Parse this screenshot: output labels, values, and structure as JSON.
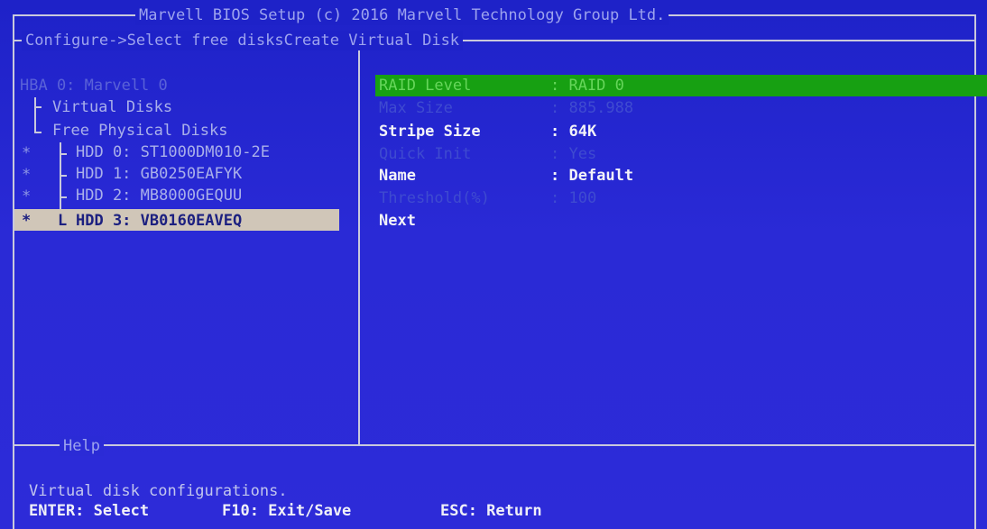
{
  "header": {
    "title": "Marvell BIOS Setup (c) 2016 Marvell Technology Group Ltd.",
    "breadcrumb": "Configure->Select free disksCreate Virtual Disk"
  },
  "tree": {
    "root": "HBA 0: Marvell 0",
    "virtual_disks": "Virtual Disks",
    "free_physical_disks": "Free Physical Disks",
    "disks": [
      {
        "marker": "*",
        "label": "HDD 0: ST1000DM010-2E",
        "selected": false
      },
      {
        "marker": "*",
        "label": "HDD 1: GB0250EAFYK",
        "selected": false
      },
      {
        "marker": "*",
        "label": "HDD 2: MB8000GEQUU",
        "selected": false
      },
      {
        "marker": "*",
        "label": "HDD 3: VB0160EAVEQ",
        "selected": true
      }
    ]
  },
  "config": {
    "rows": [
      {
        "label": "RAID Level",
        "value": ": RAID 0",
        "state": "highlight"
      },
      {
        "label": "Max Size",
        "value": ": 885.988",
        "state": "dim"
      },
      {
        "label": "Stripe Size",
        "value": ": 64K",
        "state": "normal"
      },
      {
        "label": "Quick Init",
        "value": ": Yes",
        "state": "dim"
      },
      {
        "label": "Name",
        "value": ": Default",
        "state": "normal"
      },
      {
        "label": "Threshold(%)",
        "value": ": 100",
        "state": "dim"
      },
      {
        "label": "Next",
        "value": "",
        "state": "normal"
      }
    ]
  },
  "help": {
    "title": "Help",
    "description": "Virtual disk configurations.",
    "keys": {
      "enter": "ENTER: Select",
      "f10": "F10: Exit/Save",
      "esc": "ESC: Return"
    }
  },
  "colors": {
    "background": "#2a2ad6",
    "highlight_bar": "#17a012",
    "selected_item": "#d0c6b8",
    "frame": "#c9c9dc"
  }
}
